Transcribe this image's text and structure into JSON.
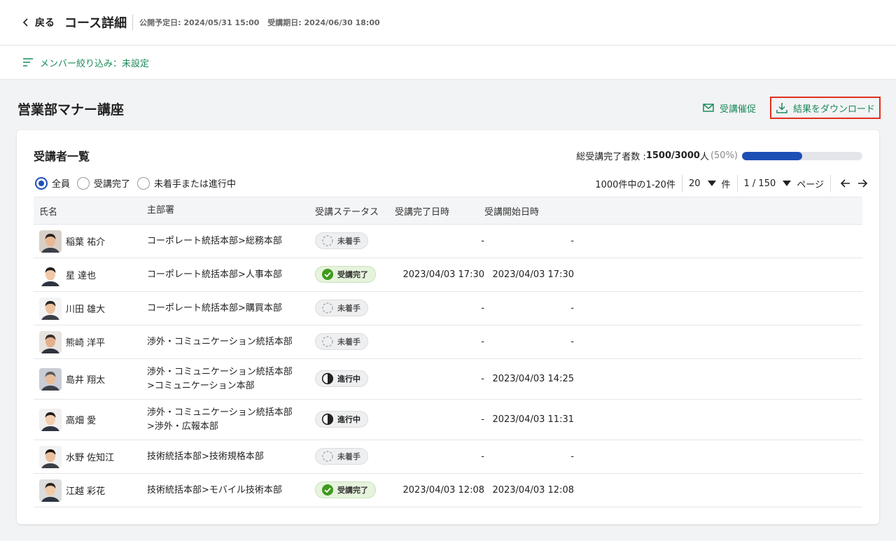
{
  "header": {
    "back_label": "戻る",
    "title": "コース詳細",
    "publish_date": "公開予定日: 2024/05/31 15:00",
    "due_date": "受講期日: 2024/06/30 18:00"
  },
  "filter": {
    "label": "メンバー絞り込み：未設定"
  },
  "course": {
    "title": "営業部マナー講座"
  },
  "actions": {
    "remind_label": "受講催促",
    "download_label": "結果をダウンロード"
  },
  "list": {
    "title": "受講者一覧",
    "completion_prefix": "総受講完了者数 : ",
    "completion_count": "1500/3000",
    "completion_unit": "人",
    "completion_pct": "(50%)",
    "completion_fraction": 0.5,
    "radios": [
      {
        "label": "全員",
        "selected": true
      },
      {
        "label": "受講完了",
        "selected": false
      },
      {
        "label": "未着手または進行中",
        "selected": false
      }
    ],
    "pager": {
      "range_text": "1000件中の1-20件",
      "per_page": "20",
      "per_page_unit": "件",
      "page": "1 / 150",
      "page_unit": "ページ"
    },
    "columns": {
      "name": "氏名",
      "dept": "主部署",
      "status": "受講ステータス",
      "done": "受講完了日時",
      "start": "受講開始日時"
    },
    "status_labels": {
      "not": "未着手",
      "done": "受講完了",
      "prog": "進行中"
    },
    "rows": [
      {
        "name": "稲葉 祐介",
        "dept": "コーポレート統括本部>総務本部",
        "dept2": "",
        "status": "not",
        "done": "-",
        "start": "-"
      },
      {
        "name": "星 達也",
        "dept": "コーポレート統括本部>人事本部",
        "dept2": "",
        "status": "done",
        "done": "2023/04/03 17:30",
        "start": "2023/04/03 17:30"
      },
      {
        "name": "川田 雄大",
        "dept": "コーポレート統括本部>購買本部",
        "dept2": "",
        "status": "not",
        "done": "-",
        "start": "-"
      },
      {
        "name": "熊崎 洋平",
        "dept": "渉外・コミュニケーション統括本部",
        "dept2": "",
        "status": "not",
        "done": "-",
        "start": "-"
      },
      {
        "name": "島井 翔太",
        "dept": "渉外・コミュニケーション統括本部",
        "dept2": ">コミュニケーション本部",
        "status": "prog",
        "done": "-",
        "start": "2023/04/03 14:25"
      },
      {
        "name": "高畑 愛",
        "dept": "渉外・コミュニケーション統括本部",
        "dept2": ">渉外・広報本部",
        "status": "prog",
        "done": "-",
        "start": "2023/04/03 11:31"
      },
      {
        "name": "水野 佐知江",
        "dept": "技術統括本部>技術規格本部",
        "dept2": "",
        "status": "not",
        "done": "-",
        "start": "-"
      },
      {
        "name": "江越 彩花",
        "dept": "技術統括本部>モバイル技術本部",
        "dept2": "",
        "status": "done",
        "done": "2023/04/03 12:08",
        "start": "2023/04/03 12:08"
      }
    ]
  },
  "colors": {
    "accent_green": "#1a8a5a",
    "progress_blue": "#1e4fb5",
    "highlight_red": "#e0301e"
  }
}
